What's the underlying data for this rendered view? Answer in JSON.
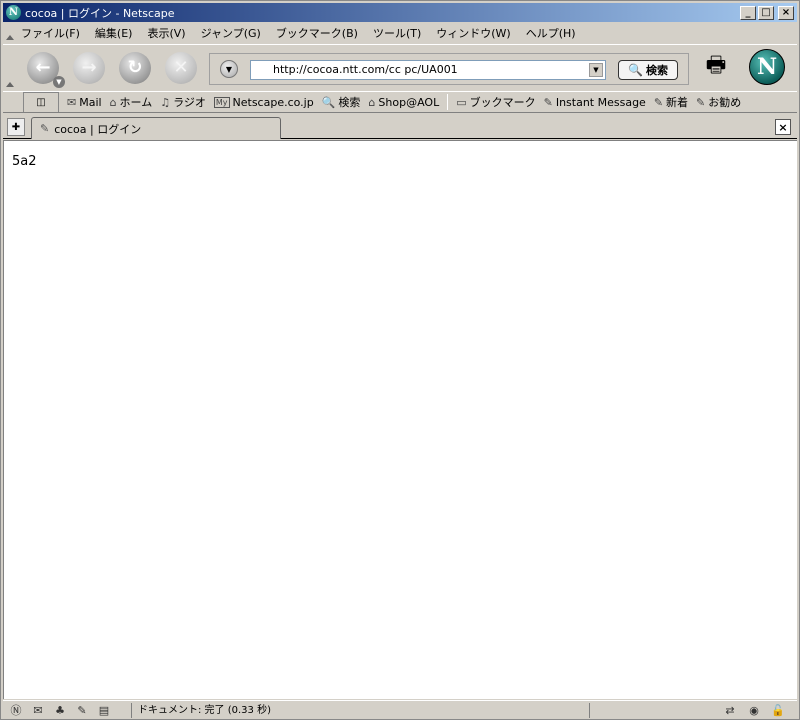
{
  "window": {
    "title": "cocoa | ログイン - Netscape",
    "app_icon": "N",
    "minimize": "_",
    "maximize": "□",
    "close": "×"
  },
  "menu": [
    {
      "label": "ファイル(F)"
    },
    {
      "label": "編集(E)"
    },
    {
      "label": "表示(V)"
    },
    {
      "label": "ジャンプ(G)"
    },
    {
      "label": "ブックマーク(B)"
    },
    {
      "label": "ツール(T)"
    },
    {
      "label": "ウィンドウ(W)"
    },
    {
      "label": "ヘルプ(H)"
    }
  ],
  "nav": {
    "url": "http://cocoa.ntt.com/cc pc/UA001",
    "search_label": "検索",
    "logo": "N"
  },
  "personal_toolbar": {
    "items": [
      {
        "label": "Mail",
        "icon": "mail-icon",
        "glyph": "✉"
      },
      {
        "label": "ホーム",
        "icon": "home-icon",
        "glyph": "⌂"
      },
      {
        "label": "ラジオ",
        "icon": "headphones-icon",
        "glyph": "♫"
      },
      {
        "label": "Netscape.co.jp",
        "icon": "my-icon",
        "glyph": "My"
      },
      {
        "label": "検索",
        "icon": "search-icon",
        "glyph": "🔍"
      },
      {
        "label": "Shop@AOL",
        "icon": "shop-icon",
        "glyph": "⌂"
      }
    ],
    "bookmarks": [
      {
        "label": "ブックマーク",
        "icon": "folder-icon",
        "glyph": "▭"
      },
      {
        "label": "Instant Message",
        "icon": "bookmark-link-icon",
        "glyph": "✎"
      },
      {
        "label": "新着",
        "icon": "bookmark-link-icon",
        "glyph": "✎"
      },
      {
        "label": "お勧め",
        "icon": "bookmark-link-icon",
        "glyph": "✎"
      }
    ]
  },
  "tabs": [
    {
      "label": "cocoa | ログイン"
    }
  ],
  "page": {
    "body_text": "5a2"
  },
  "status": {
    "text": "ドキュメント: 完了 (0.33 秒)"
  }
}
